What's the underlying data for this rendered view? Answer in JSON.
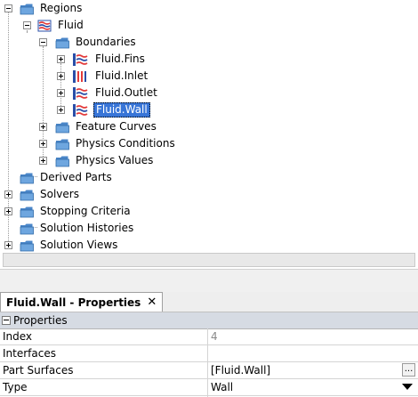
{
  "tree": {
    "regions": "Regions",
    "fluid": "Fluid",
    "boundaries": "Boundaries",
    "fins": "Fluid.Fins",
    "inlet": "Fluid.Inlet",
    "outlet": "Fluid.Outlet",
    "wall": "Fluid.Wall",
    "feature_curves": "Feature Curves",
    "physics_conditions": "Physics Conditions",
    "physics_values": "Physics Values",
    "derived_parts": "Derived Parts",
    "solvers": "Solvers",
    "stopping_criteria": "Stopping Criteria",
    "solution_histories": "Solution Histories",
    "solution_views": "Solution Views",
    "selected": "Fluid.Wall"
  },
  "tab": {
    "label": "Fluid.Wall - Properties",
    "close": "✕"
  },
  "properties": {
    "section": "Properties",
    "rows": [
      {
        "name": "Index",
        "value": "4"
      },
      {
        "name": "Interfaces",
        "value": ""
      },
      {
        "name": "Part Surfaces",
        "value": "[Fluid.Wall]",
        "button": "..."
      },
      {
        "name": "Type",
        "value": "Wall"
      }
    ]
  },
  "colors": {
    "selection": "#3875d7",
    "folder": "#4a86c8",
    "boundary_red": "#e23b3b",
    "section_header": "#d6dbe3"
  },
  "icons": [
    "folder-icon",
    "region-icon",
    "boundary-wall-icon",
    "boundary-inlet-icon",
    "expand-icon",
    "collapse-icon",
    "close-icon",
    "ellipsis-icon",
    "dropdown-arrow-icon"
  ]
}
